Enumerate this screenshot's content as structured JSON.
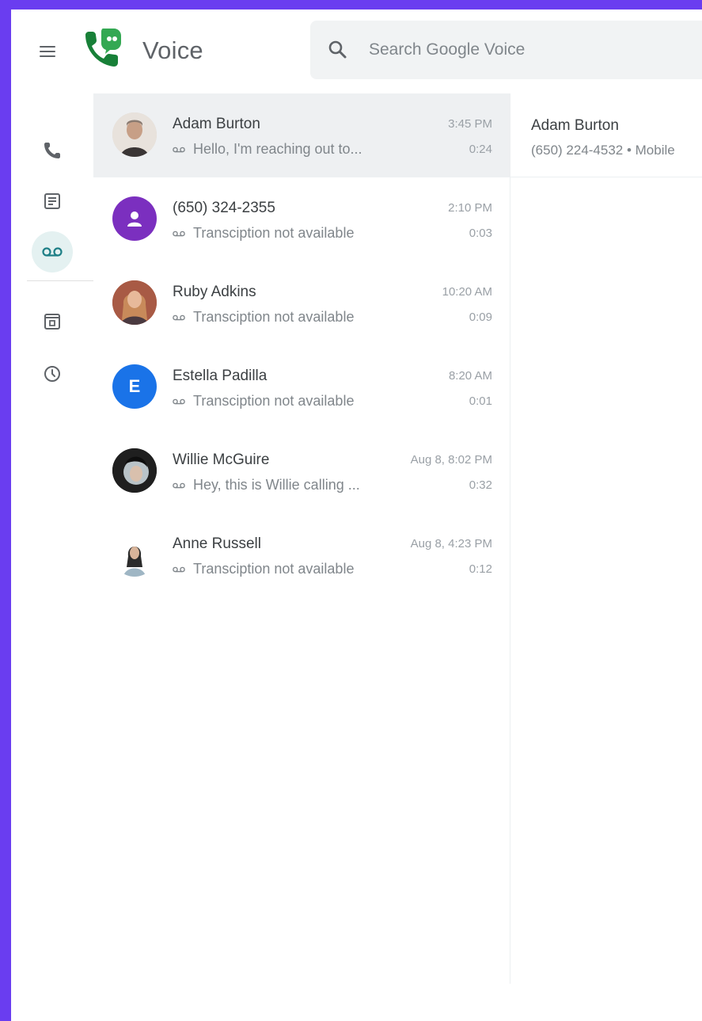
{
  "header": {
    "app_title": "Voice",
    "search_placeholder": "Search Google Voice"
  },
  "rail": {
    "items": [
      {
        "icon": "phone-icon",
        "active": false
      },
      {
        "icon": "messages-icon",
        "active": false
      },
      {
        "icon": "voicemail-icon",
        "active": true
      },
      {
        "icon": "archive-icon",
        "active": false
      },
      {
        "icon": "history-icon",
        "active": false
      }
    ]
  },
  "list": {
    "items": [
      {
        "name": "Adam Burton",
        "preview": "Hello, I'm reaching out to...",
        "time": "3:45 PM",
        "duration": "0:24",
        "avatar": "photo",
        "selected": true
      },
      {
        "name": "(650) 324-2355",
        "preview": "Transciption not available",
        "time": "2:10 PM",
        "duration": "0:03",
        "avatar": "person-icon",
        "color": "#7b2fbf"
      },
      {
        "name": "Ruby Adkins",
        "preview": "Transciption not available",
        "time": "10:20 AM",
        "duration": "0:09",
        "avatar": "photo"
      },
      {
        "name": "Estella Padilla",
        "preview": "Transciption not available",
        "time": "8:20 AM",
        "duration": "0:01",
        "avatar": "E",
        "color": "#1a73e8"
      },
      {
        "name": "Willie McGuire",
        "preview": "Hey, this is Willie calling ...",
        "time": "Aug 8, 8:02 PM",
        "duration": "0:32",
        "avatar": "photo"
      },
      {
        "name": "Anne Russell",
        "preview": "Transciption not available",
        "time": "Aug 8, 4:23 PM",
        "duration": "0:12",
        "avatar": "photo"
      }
    ]
  },
  "detail": {
    "name": "Adam Burton",
    "subtitle": "(650) 224-4532 • Mobile"
  },
  "colors": {
    "frame": "#6a3df0",
    "brand_green": "#188038",
    "selected_row": "#eef0f2",
    "active_rail": "#e4f1f1"
  }
}
